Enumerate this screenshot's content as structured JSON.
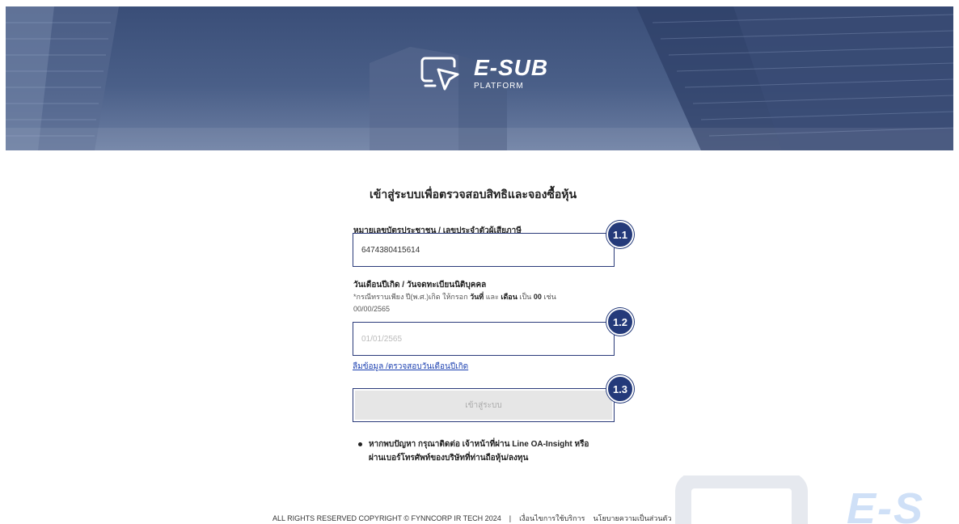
{
  "header": {
    "logo_main": "E-SUB",
    "logo_sub": "PLATFORM"
  },
  "form": {
    "title": "เข้าสู่ระบบเพื่อตรวจสอบสิทธิและจองซื้อหุ้น",
    "id_label": "หมายเลขบัตรประชาชน / เลขประจำตัวผู้เสียภาษี",
    "id_value": "6474380415614",
    "dob_label": "วันเดือนปีเกิด / วันจดทะเบียนนิติบุคคล",
    "dob_hint_prefix": "*กรณีทราบเพียง ปี(พ.ศ.)เกิด ให้กรอก",
    "dob_hint_day": "วันที่",
    "dob_hint_and": "และ",
    "dob_hint_month": "เดือน",
    "dob_hint_as": "เป็น",
    "dob_hint_zero": "00",
    "dob_hint_eg": "เช่น",
    "dob_hint_example": "00/00/2565",
    "dob_placeholder": "01/01/2565",
    "forgot_link": "ลืมข้อมูล /ตรวจสอบวันเดือนปีเกิด",
    "submit_label": "เข้าสู่ระบบ",
    "badge_1": "1.1",
    "badge_2": "1.2",
    "badge_3": "1.3"
  },
  "note": {
    "line1": "หากพบปัญหา กรุณาติดต่อ เจ้าหน้าที่ผ่าน Line OA-Insight หรือ",
    "line2": "ผ่านเบอร์โทรศัพท์ของบริษัทที่ท่านถือหุ้น/ลงทุน"
  },
  "footer": {
    "copyright": "ALL RIGHTS RESERVED COPYRIGHT © FYNNCORP IR TECH 2024",
    "separator": "|",
    "terms": "เงื่อนไขการใช้บริการ",
    "privacy": "นโยบายความเป็นส่วนตัว"
  },
  "watermark": {
    "text": "E-S"
  },
  "colors": {
    "accent": "#243a7a",
    "link": "#1a3fb0",
    "hero": "#3a4e78"
  }
}
